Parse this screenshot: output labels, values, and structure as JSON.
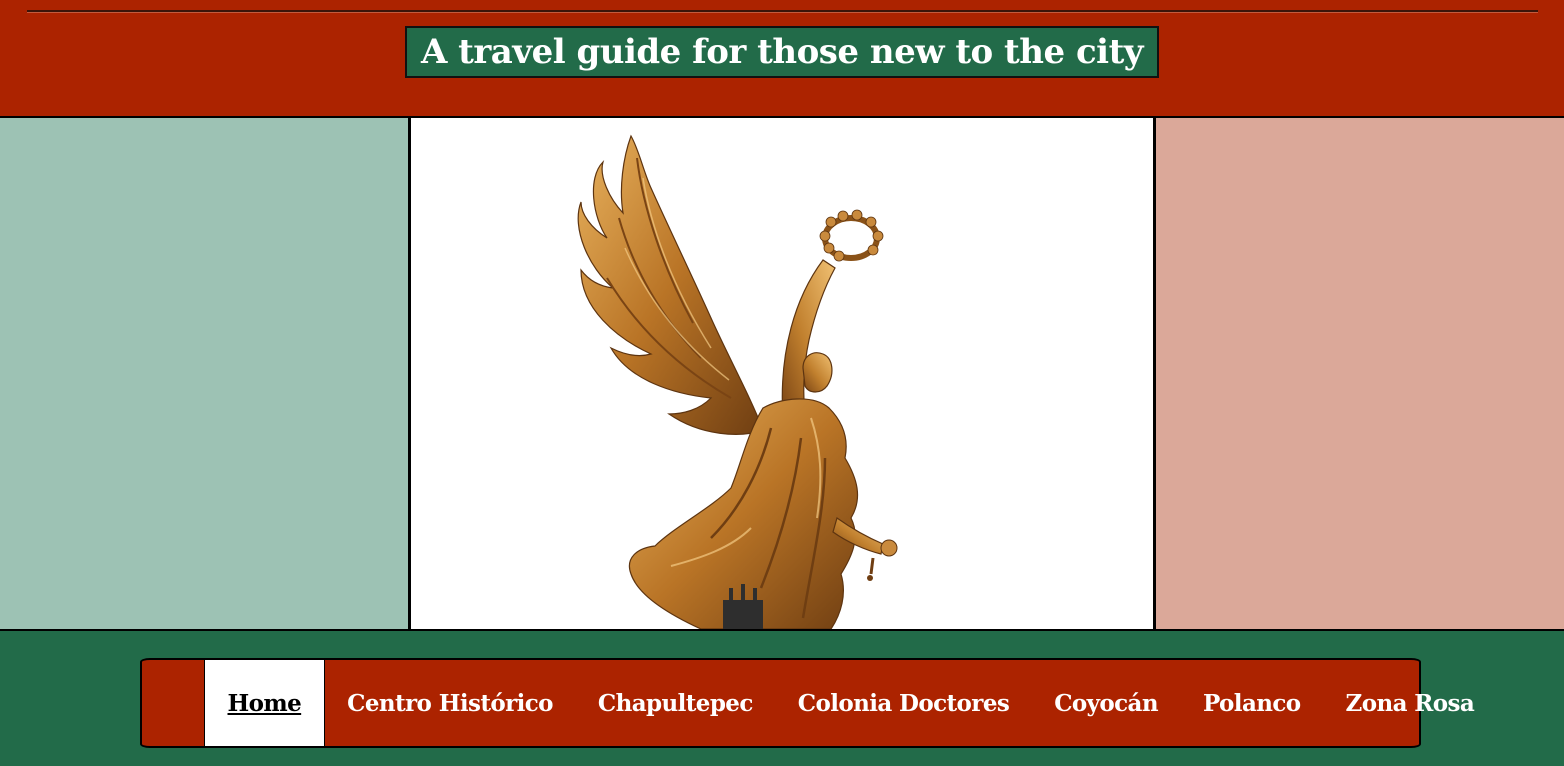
{
  "header": {
    "tagline": "A travel guide for those new to the city"
  },
  "hero": {
    "image_subject": "angel-of-independence-statue-icon"
  },
  "nav": {
    "items": [
      {
        "label": "Home",
        "active": true
      },
      {
        "label": "Centro Histórico",
        "active": false
      },
      {
        "label": "Chapultepec",
        "active": false
      },
      {
        "label": "Colonia Doctores",
        "active": false
      },
      {
        "label": "Coyocán",
        "active": false
      },
      {
        "label": "Polanco",
        "active": false
      },
      {
        "label": "Zona Rosa",
        "active": false
      }
    ]
  },
  "colors": {
    "red": "#ac2300",
    "green": "#226b49",
    "light_green": "#9dc2b4",
    "light_red": "#dba899",
    "gold": "#c98a3d"
  }
}
